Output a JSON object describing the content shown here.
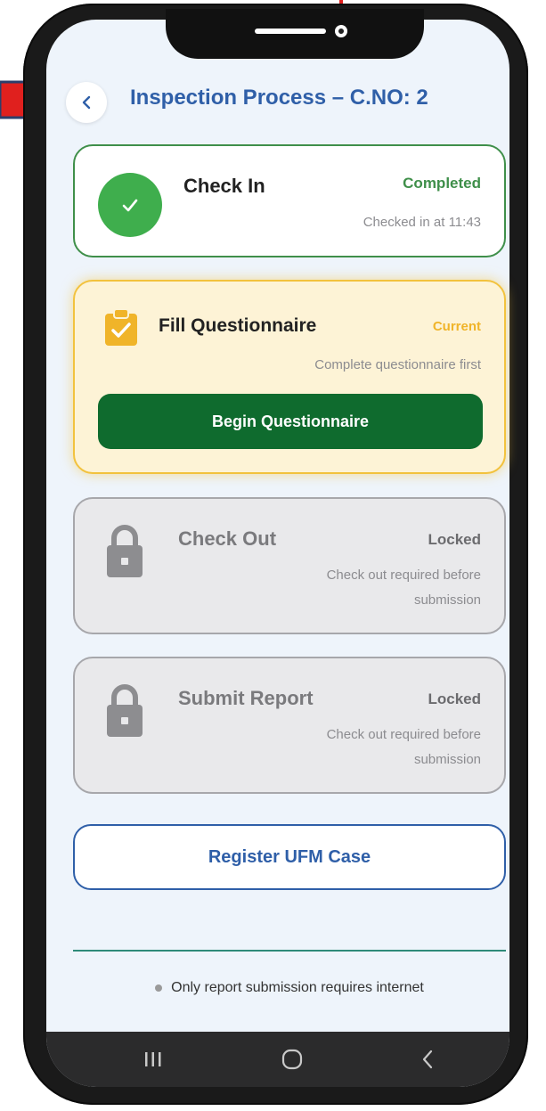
{
  "header": {
    "back_icon": "chevron-left-icon",
    "title": "Inspection Process – C.NO: 2"
  },
  "steps": [
    {
      "title": "Check In",
      "status": "Completed",
      "status_color": "#3f8f4a",
      "description": "Checked in at 11:43",
      "icon": "checkmark-circle-icon"
    },
    {
      "title": "Fill Questionnaire",
      "status": "Current",
      "status_color": "#f0b429",
      "description": "Complete questionnaire first",
      "icon": "clipboard-check-icon",
      "action_label": "Begin Questionnaire"
    },
    {
      "title": "Check Out",
      "status": "Locked",
      "status_color": "#6b6b6e",
      "description_line1": "Check out required before",
      "description_line2": "submission",
      "icon": "lock-icon"
    },
    {
      "title": "Submit Report",
      "status": "Locked",
      "status_color": "#6b6b6e",
      "description_line1": "Check out required before",
      "description_line2": "submission",
      "icon": "lock-icon"
    }
  ],
  "register_ufm_label": "Register UFM Case",
  "footer_note": "Only report submission requires internet",
  "nav": {
    "recents_icon": "recents-icon",
    "home_icon": "home-icon",
    "back_icon": "back-icon"
  },
  "colors": {
    "primary": "#2f5fa8",
    "success": "#3fae4d",
    "action": "#0f6b2e",
    "current_bg": "#fdf3d6",
    "current_border": "#f2c23e",
    "annotation": "#e0201e"
  }
}
